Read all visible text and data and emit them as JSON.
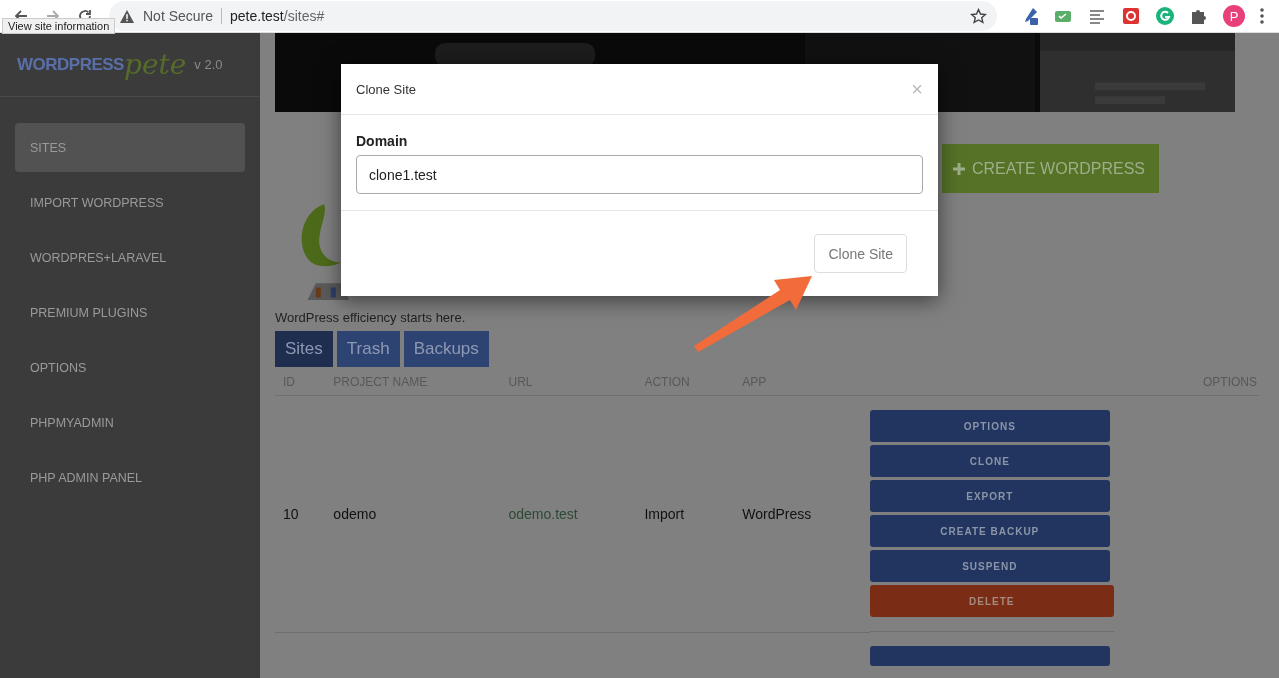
{
  "browser": {
    "security": "Not Secure",
    "url_host": "pete.test",
    "url_path": "/sites#",
    "tooltip": "View site information",
    "profile_initial": "P"
  },
  "sidebar": {
    "logo_word": "WORDPRESS",
    "logo_script": "pete",
    "version": "v 2.0",
    "items": [
      {
        "label": "SITES",
        "selected": true
      },
      {
        "label": "IMPORT WORDPRESS",
        "selected": false
      },
      {
        "label": "WORDPRES+LARAVEL",
        "selected": false
      },
      {
        "label": "PREMIUM PLUGINS",
        "selected": false
      },
      {
        "label": "OPTIONS",
        "selected": false
      },
      {
        "label": "PHPMYADMIN",
        "selected": false
      },
      {
        "label": "PHP ADMIN PANEL",
        "selected": false
      }
    ]
  },
  "main": {
    "create_button": "CREATE WORDPRESS",
    "tagline": "WordPress efficiency starts here.",
    "tabs": [
      {
        "label": "Sites",
        "selected": true
      },
      {
        "label": "Trash",
        "selected": false
      },
      {
        "label": "Backups",
        "selected": false
      }
    ],
    "table": {
      "columns": [
        "ID",
        "PROJECT NAME",
        "URL",
        "ACTION",
        "APP",
        "OPTIONS"
      ],
      "rows": [
        {
          "id": "10",
          "project_name": "odemo",
          "url": "odemo.test",
          "action": "Import",
          "app": "WordPress",
          "options": [
            {
              "label": "OPTIONS",
              "kind": "primary"
            },
            {
              "label": "CLONE",
              "kind": "primary"
            },
            {
              "label": "EXPORT",
              "kind": "primary"
            },
            {
              "label": "CREATE BACKUP",
              "kind": "primary"
            },
            {
              "label": "SUSPEND",
              "kind": "primary"
            },
            {
              "label": "DELETE",
              "kind": "danger"
            }
          ]
        }
      ]
    }
  },
  "modal": {
    "title": "Clone Site",
    "close": "×",
    "field_label": "Domain",
    "field_value": "clone1.test",
    "submit": "Clone Site"
  }
}
